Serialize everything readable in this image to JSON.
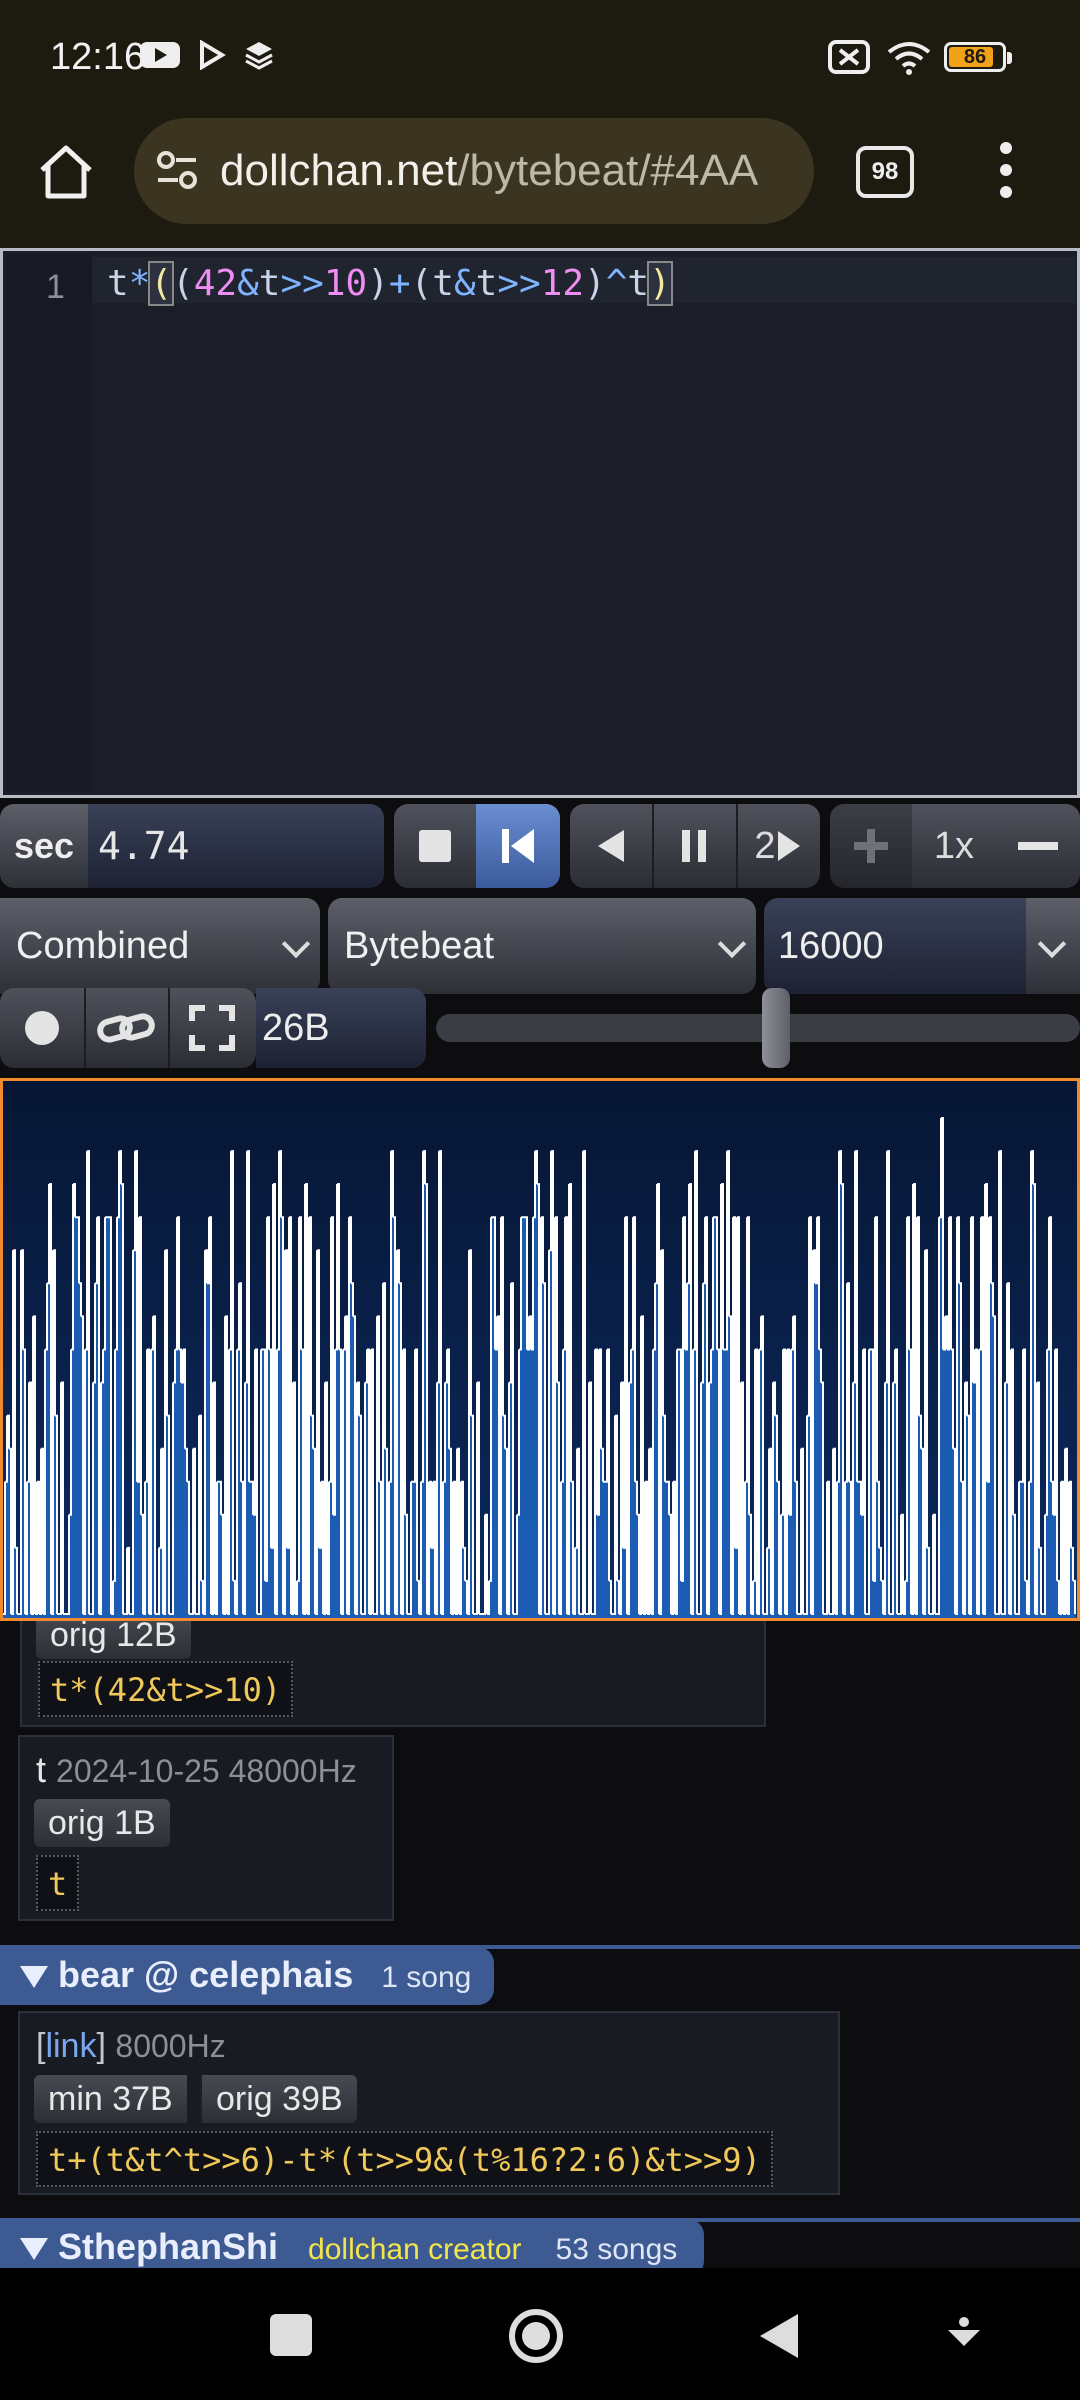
{
  "status_bar": {
    "time": "12:16",
    "battery": "86",
    "icons": [
      "youtube-icon",
      "play-store-icon",
      "layers-icon",
      "no-sim-icon",
      "wifi-icon",
      "battery-icon"
    ]
  },
  "browser": {
    "url_domain": "dollchan.net",
    "url_path": "/bytebeat/#4AA",
    "tab_count": "98"
  },
  "editor": {
    "line_number": "1",
    "code_tokens": [
      {
        "t": "t",
        "c": "c-id"
      },
      {
        "t": "*",
        "c": "c-op"
      },
      {
        "t": "(",
        "c": "c-hl"
      },
      {
        "t": "(",
        "c": "c-br"
      },
      {
        "t": "42",
        "c": "c-num"
      },
      {
        "t": "&",
        "c": "c-op"
      },
      {
        "t": "t",
        "c": "c-id"
      },
      {
        "t": ">>",
        "c": "c-op"
      },
      {
        "t": "10",
        "c": "c-num"
      },
      {
        "t": ")",
        "c": "c-br"
      },
      {
        "t": "+",
        "c": "c-op"
      },
      {
        "t": "(",
        "c": "c-br"
      },
      {
        "t": "t",
        "c": "c-id"
      },
      {
        "t": "&",
        "c": "c-op"
      },
      {
        "t": "t",
        "c": "c-id"
      },
      {
        "t": ">>",
        "c": "c-op"
      },
      {
        "t": "12",
        "c": "c-num"
      },
      {
        "t": ")",
        "c": "c-br"
      },
      {
        "t": "^",
        "c": "c-op"
      },
      {
        "t": "t",
        "c": "c-id"
      },
      {
        "t": ")",
        "c": "c-hl"
      }
    ]
  },
  "controls": {
    "time_unit": "sec",
    "time_value": "4.74",
    "reverse_speed": "2",
    "speed": "1x",
    "mode": "Combined",
    "type": "Bytebeat",
    "sample_rate": "16000",
    "size": "26B",
    "volume_fraction": 0.53
  },
  "library": {
    "partial_card": {
      "size_pill": "orig 12B",
      "code": "t*(42&t>>10)"
    },
    "card_t": {
      "name": "t",
      "meta": "2024-10-25 48000Hz",
      "size_pill": "orig 1B",
      "code": "t"
    },
    "bear": {
      "header": "bear @ celephais",
      "count": "1 song",
      "link": "link",
      "meta": "8000Hz",
      "min_pill": "min 37B",
      "orig_pill": "orig 39B",
      "code": "t+(t&t^t>>6)-t*(t>>9&(t%16?2:6)&t>>9)"
    },
    "sthephan": {
      "header": "SthephanShi",
      "role": "dollchan creator",
      "count": "53 songs"
    }
  },
  "colors": {
    "accent_orange": "#f08a2c",
    "code_yellow": "#f0c95a",
    "header_blue": "#3d5a92"
  }
}
